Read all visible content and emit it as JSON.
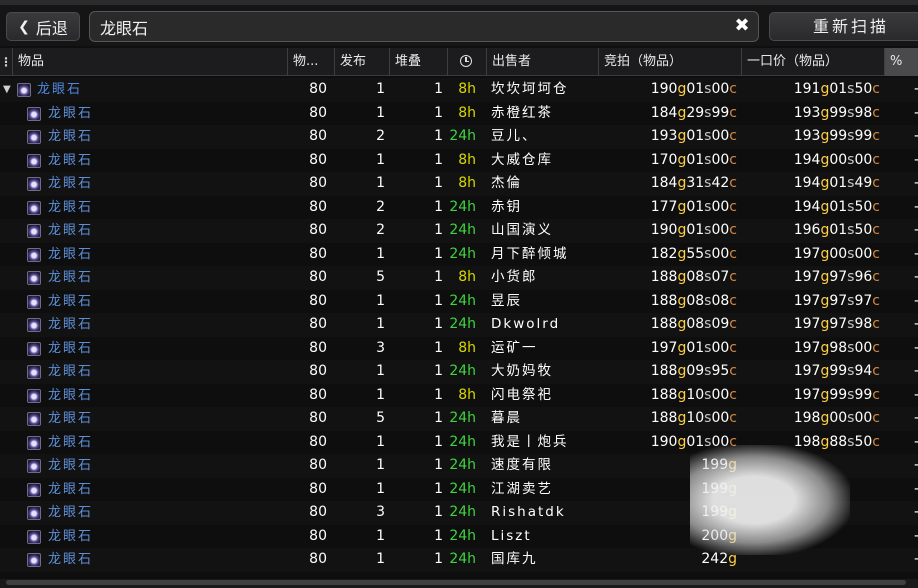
{
  "toolbar": {
    "back_label": "后退",
    "search_value": "龙眼石",
    "rescan_label": "重新扫描"
  },
  "columns": {
    "item": "物品",
    "level": "物...",
    "posted": "发布",
    "stack": "堆叠",
    "seller": "出售者",
    "bid": "竞拍（物品）",
    "buyout": "一口价（物品）",
    "pct": "%"
  },
  "time_colors": {
    "short": "#d8d800",
    "long": "#3fd43f"
  },
  "rows": [
    {
      "name": "龙眼石",
      "parent": true,
      "level": "80",
      "posted": "1",
      "stack": "1",
      "time": "8h",
      "seller": "坎坎坷坷仓",
      "bid": {
        "g": "190",
        "s": "01",
        "c": "00"
      },
      "buy": {
        "g": "191",
        "s": "01",
        "c": "50"
      },
      "pct": "-"
    },
    {
      "name": "龙眼石",
      "level": "80",
      "posted": "1",
      "stack": "1",
      "time": "8h",
      "seller": "赤橙红茶",
      "bid": {
        "g": "184",
        "s": "29",
        "c": "99"
      },
      "buy": {
        "g": "193",
        "s": "99",
        "c": "98"
      },
      "pct": "-"
    },
    {
      "name": "龙眼石",
      "level": "80",
      "posted": "2",
      "stack": "1",
      "time": "24h",
      "seller": "豆儿、",
      "bid": {
        "g": "193",
        "s": "01",
        "c": "00"
      },
      "buy": {
        "g": "193",
        "s": "99",
        "c": "99"
      },
      "pct": "-"
    },
    {
      "name": "龙眼石",
      "level": "80",
      "posted": "1",
      "stack": "1",
      "time": "8h",
      "seller": "大威仓库",
      "bid": {
        "g": "170",
        "s": "01",
        "c": "00"
      },
      "buy": {
        "g": "194",
        "s": "00",
        "c": "00"
      },
      "pct": "-"
    },
    {
      "name": "龙眼石",
      "level": "80",
      "posted": "1",
      "stack": "1",
      "time": "8h",
      "seller": "杰倫",
      "bid": {
        "g": "184",
        "s": "31",
        "c": "42"
      },
      "buy": {
        "g": "194",
        "s": "01",
        "c": "49"
      },
      "pct": "-"
    },
    {
      "name": "龙眼石",
      "level": "80",
      "posted": "2",
      "stack": "1",
      "time": "24h",
      "seller": "赤钥",
      "bid": {
        "g": "177",
        "s": "01",
        "c": "00"
      },
      "buy": {
        "g": "194",
        "s": "01",
        "c": "50"
      },
      "pct": "-"
    },
    {
      "name": "龙眼石",
      "level": "80",
      "posted": "2",
      "stack": "1",
      "time": "24h",
      "seller": "山国演义",
      "bid": {
        "g": "190",
        "s": "01",
        "c": "00"
      },
      "buy": {
        "g": "196",
        "s": "01",
        "c": "50"
      },
      "pct": "-"
    },
    {
      "name": "龙眼石",
      "level": "80",
      "posted": "1",
      "stack": "1",
      "time": "24h",
      "seller": "月下醉倾城",
      "bid": {
        "g": "182",
        "s": "55",
        "c": "00"
      },
      "buy": {
        "g": "197",
        "s": "00",
        "c": "00"
      },
      "pct": "-"
    },
    {
      "name": "龙眼石",
      "level": "80",
      "posted": "5",
      "stack": "1",
      "time": "8h",
      "seller": "小货郎",
      "bid": {
        "g": "188",
        "s": "08",
        "c": "07"
      },
      "buy": {
        "g": "197",
        "s": "97",
        "c": "96"
      },
      "pct": "-"
    },
    {
      "name": "龙眼石",
      "level": "80",
      "posted": "1",
      "stack": "1",
      "time": "24h",
      "seller": "昱辰",
      "bid": {
        "g": "188",
        "s": "08",
        "c": "08"
      },
      "buy": {
        "g": "197",
        "s": "97",
        "c": "97"
      },
      "pct": "-"
    },
    {
      "name": "龙眼石",
      "level": "80",
      "posted": "1",
      "stack": "1",
      "time": "24h",
      "seller": "Dkwolrd",
      "bid": {
        "g": "188",
        "s": "08",
        "c": "09"
      },
      "buy": {
        "g": "197",
        "s": "97",
        "c": "98"
      },
      "pct": "-"
    },
    {
      "name": "龙眼石",
      "level": "80",
      "posted": "3",
      "stack": "1",
      "time": "8h",
      "seller": "运矿一",
      "bid": {
        "g": "197",
        "s": "01",
        "c": "00"
      },
      "buy": {
        "g": "197",
        "s": "98",
        "c": "00"
      },
      "pct": "-"
    },
    {
      "name": "龙眼石",
      "level": "80",
      "posted": "1",
      "stack": "1",
      "time": "24h",
      "seller": "大奶妈牧",
      "bid": {
        "g": "188",
        "s": "09",
        "c": "95"
      },
      "buy": {
        "g": "197",
        "s": "99",
        "c": "94"
      },
      "pct": "-"
    },
    {
      "name": "龙眼石",
      "level": "80",
      "posted": "1",
      "stack": "1",
      "time": "8h",
      "seller": "闪电祭祀",
      "bid": {
        "g": "188",
        "s": "10",
        "c": "00"
      },
      "buy": {
        "g": "197",
        "s": "99",
        "c": "99"
      },
      "pct": "-"
    },
    {
      "name": "龙眼石",
      "level": "80",
      "posted": "5",
      "stack": "1",
      "time": "24h",
      "seller": "暮晨",
      "bid": {
        "g": "188",
        "s": "10",
        "c": "00"
      },
      "buy": {
        "g": "198",
        "s": "00",
        "c": "00"
      },
      "pct": "-"
    },
    {
      "name": "龙眼石",
      "level": "80",
      "posted": "1",
      "stack": "1",
      "time": "24h",
      "seller": "我是丨炮兵",
      "bid": {
        "g": "190",
        "s": "01",
        "c": "00"
      },
      "buy": {
        "g": "198",
        "s": "88",
        "c": "50"
      },
      "pct": "-"
    },
    {
      "name": "龙眼石",
      "level": "80",
      "posted": "1",
      "stack": "1",
      "time": "24h",
      "seller": "速度有限",
      "bid": {
        "g": "199",
        "s": "",
        "c": ""
      },
      "buy": {
        "g": "",
        "s": "",
        "c": ""
      },
      "pct": "-"
    },
    {
      "name": "龙眼石",
      "level": "80",
      "posted": "1",
      "stack": "1",
      "time": "24h",
      "seller": "江湖卖艺",
      "bid": {
        "g": "199",
        "s": "",
        "c": ""
      },
      "buy": {
        "g": "",
        "s": "",
        "c": ""
      },
      "pct": "-"
    },
    {
      "name": "龙眼石",
      "level": "80",
      "posted": "3",
      "stack": "1",
      "time": "24h",
      "seller": "Rishatdk",
      "bid": {
        "g": "199",
        "s": "",
        "c": ""
      },
      "buy": {
        "g": "",
        "s": "",
        "c": ""
      },
      "pct": "-"
    },
    {
      "name": "龙眼石",
      "level": "80",
      "posted": "1",
      "stack": "1",
      "time": "24h",
      "seller": "Liszt",
      "bid": {
        "g": "200",
        "s": "",
        "c": ""
      },
      "buy": {
        "g": "",
        "s": "",
        "c": ""
      },
      "pct": "-"
    },
    {
      "name": "龙眼石",
      "level": "80",
      "posted": "1",
      "stack": "1",
      "time": "24h",
      "seller": "国库九",
      "bid": {
        "g": "242",
        "s": "",
        "c": ""
      },
      "buy": {
        "g": "",
        "s": "",
        "c": ""
      },
      "pct": "-"
    }
  ]
}
